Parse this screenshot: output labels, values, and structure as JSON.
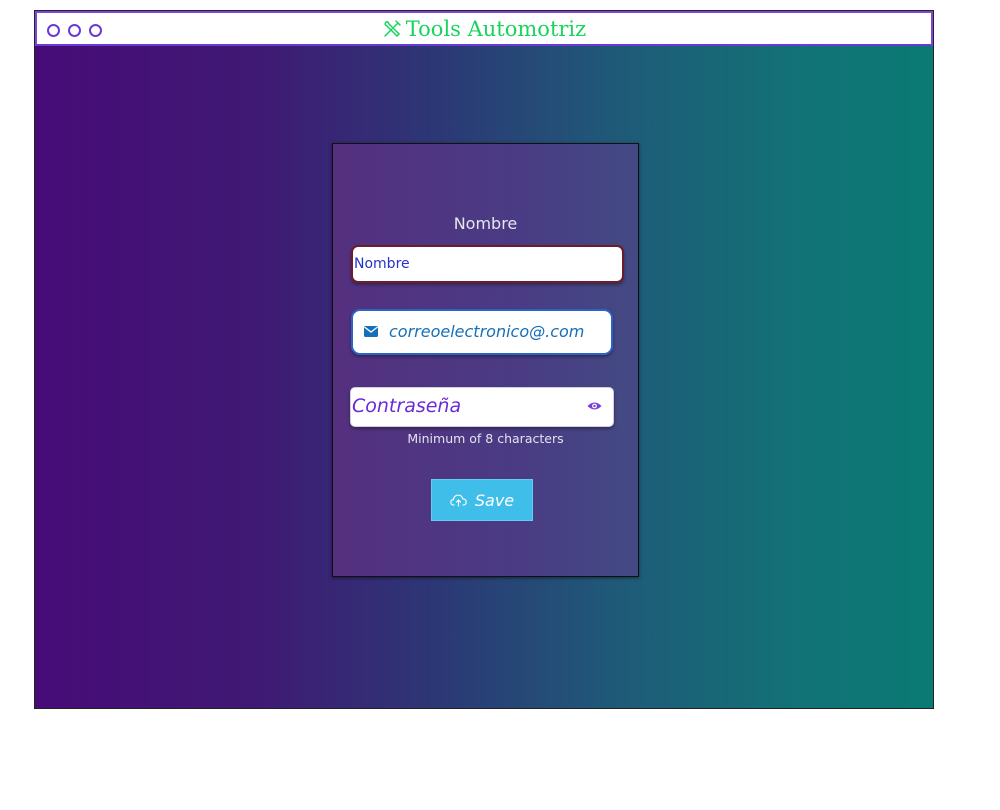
{
  "window": {
    "title": "Tools Automotriz",
    "title_icon": "tools-icon",
    "controls": [
      "window-dot-1",
      "window-dot-2",
      "window-dot-3"
    ]
  },
  "form": {
    "name_label": "Nombre",
    "name_input_value": "Nombre",
    "email_icon": "envelope-icon",
    "email_value": "correoelectronico@.com",
    "password_placeholder": "Contraseña",
    "password_toggle_icon": "eye-icon",
    "password_hint": "Minimum of 8 characters",
    "save_label": "Save",
    "save_icon": "cloud-upload-icon"
  },
  "colors": {
    "title_text": "#19d35f",
    "titlebar_border": "#7b46e0",
    "gradient_start": "#470b78",
    "gradient_end": "#0a7a74",
    "card_bg": "#4f3385",
    "save_button": "#3fbeea",
    "email_text": "#1670b8",
    "password_placeholder": "#6a2bd6"
  }
}
